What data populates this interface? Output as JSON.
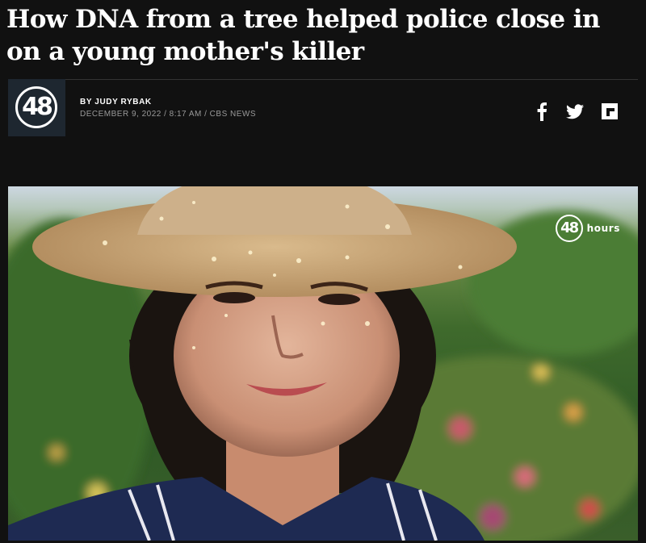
{
  "article": {
    "headline": "How DNA from a tree helped police close in on a young mother's killer",
    "byline": "BY JUDY RYBAK",
    "dateline": "DECEMBER 9, 2022 / 8:17 AM / CBS NEWS"
  },
  "logo": {
    "text": "48",
    "icon": "48-hours-logo"
  },
  "share": {
    "facebook_icon": "facebook-icon",
    "twitter_icon": "twitter-icon",
    "flipboard_icon": "flipboard-icon"
  },
  "photo": {
    "watermark_number": "48",
    "watermark_text": "hours"
  },
  "colors": {
    "background": "#111111",
    "text": "#ffffff",
    "meta": "#9a9a9a",
    "logo_bg": "#1e2730"
  }
}
